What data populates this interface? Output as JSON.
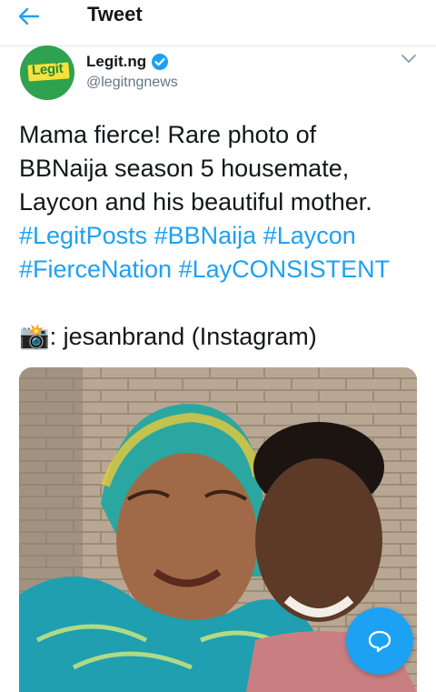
{
  "header": {
    "title": "Tweet",
    "back_icon": "arrow-left-icon"
  },
  "tweet": {
    "author_name": "Legit.ng",
    "author_handle": "@legitngnews",
    "avatar_logo_text": "Legit",
    "verified_icon": "verified-badge-icon",
    "menu_icon": "chevron-down-icon",
    "line1": "Mama fierce! Rare photo of",
    "line2": "BBNaija season 5 housemate,",
    "line3": "Laycon and his beautiful mother.",
    "hashtags_row1": [
      "#LegitPosts",
      "#BBNaija",
      "#Laycon"
    ],
    "hashtags_row2": [
      "#FierceNation",
      "#LayCONSISTENT"
    ],
    "credit_emoji": "📸",
    "credit_text": ": jesanbrand (Instagram)",
    "photo_alt": "photo"
  },
  "fab": {
    "icon": "reply-bubble-icon"
  },
  "colors": {
    "accent": "#1da1f2",
    "text": "#14171a",
    "secondary": "#657786",
    "logo_green": "#2fa24f",
    "logo_yellow": "#f7e23b"
  }
}
